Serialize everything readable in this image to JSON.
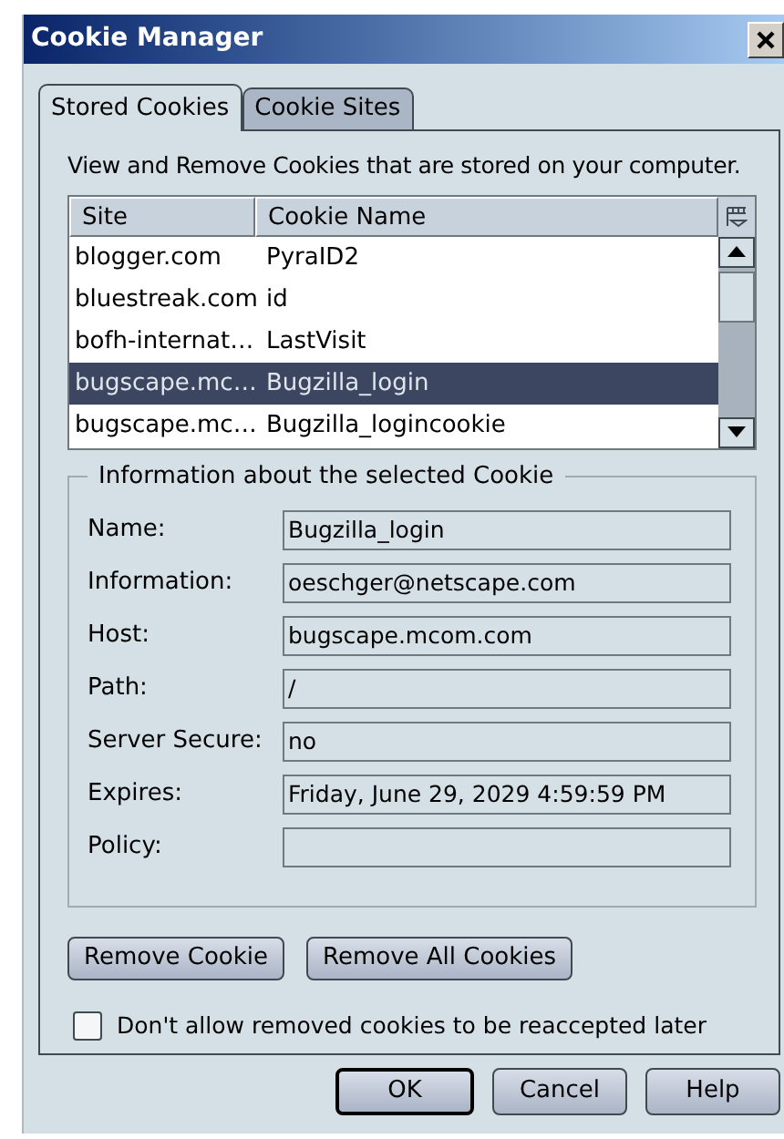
{
  "window": {
    "title": "Cookie Manager"
  },
  "tabs": [
    {
      "label": "Stored Cookies",
      "selected": true
    },
    {
      "label": "Cookie Sites",
      "selected": false
    }
  ],
  "description": "View and Remove Cookies that are stored on your computer.",
  "table": {
    "columns": [
      "Site",
      "Cookie Name"
    ],
    "rows": [
      {
        "site": "blogger.com",
        "cookie_name": "PyraID2",
        "selected": false
      },
      {
        "site": "bluestreak.com",
        "cookie_name": "id",
        "selected": false
      },
      {
        "site": "bofh-internat…",
        "cookie_name": "LastVisit",
        "selected": false
      },
      {
        "site": "bugscape.mc…",
        "cookie_name": "Bugzilla_login",
        "selected": true
      },
      {
        "site": "bugscape.mc…",
        "cookie_name": "Bugzilla_logincookie",
        "selected": false
      }
    ]
  },
  "details": {
    "title": "Information about the selected Cookie",
    "fields": [
      {
        "label": "Name:",
        "value": "Bugzilla_login"
      },
      {
        "label": "Information:",
        "value": "oeschger@netscape.com"
      },
      {
        "label": "Host:",
        "value": "bugscape.mcom.com"
      },
      {
        "label": "Path:",
        "value": "/"
      },
      {
        "label": "Server Secure:",
        "value": "no"
      },
      {
        "label": "Expires:",
        "value": "Friday, June 29, 2029 4:59:59 PM"
      },
      {
        "label": "Policy:"
      }
    ]
  },
  "actions": [
    "Remove Cookie",
    "Remove All Cookies"
  ],
  "checkbox": {
    "label": "Don't allow removed cookies to be reaccepted later",
    "checked": false
  },
  "dialog_buttons": [
    {
      "label": "OK",
      "default": true
    },
    {
      "label": "Cancel",
      "default": false
    },
    {
      "label": "Help",
      "default": false
    }
  ]
}
